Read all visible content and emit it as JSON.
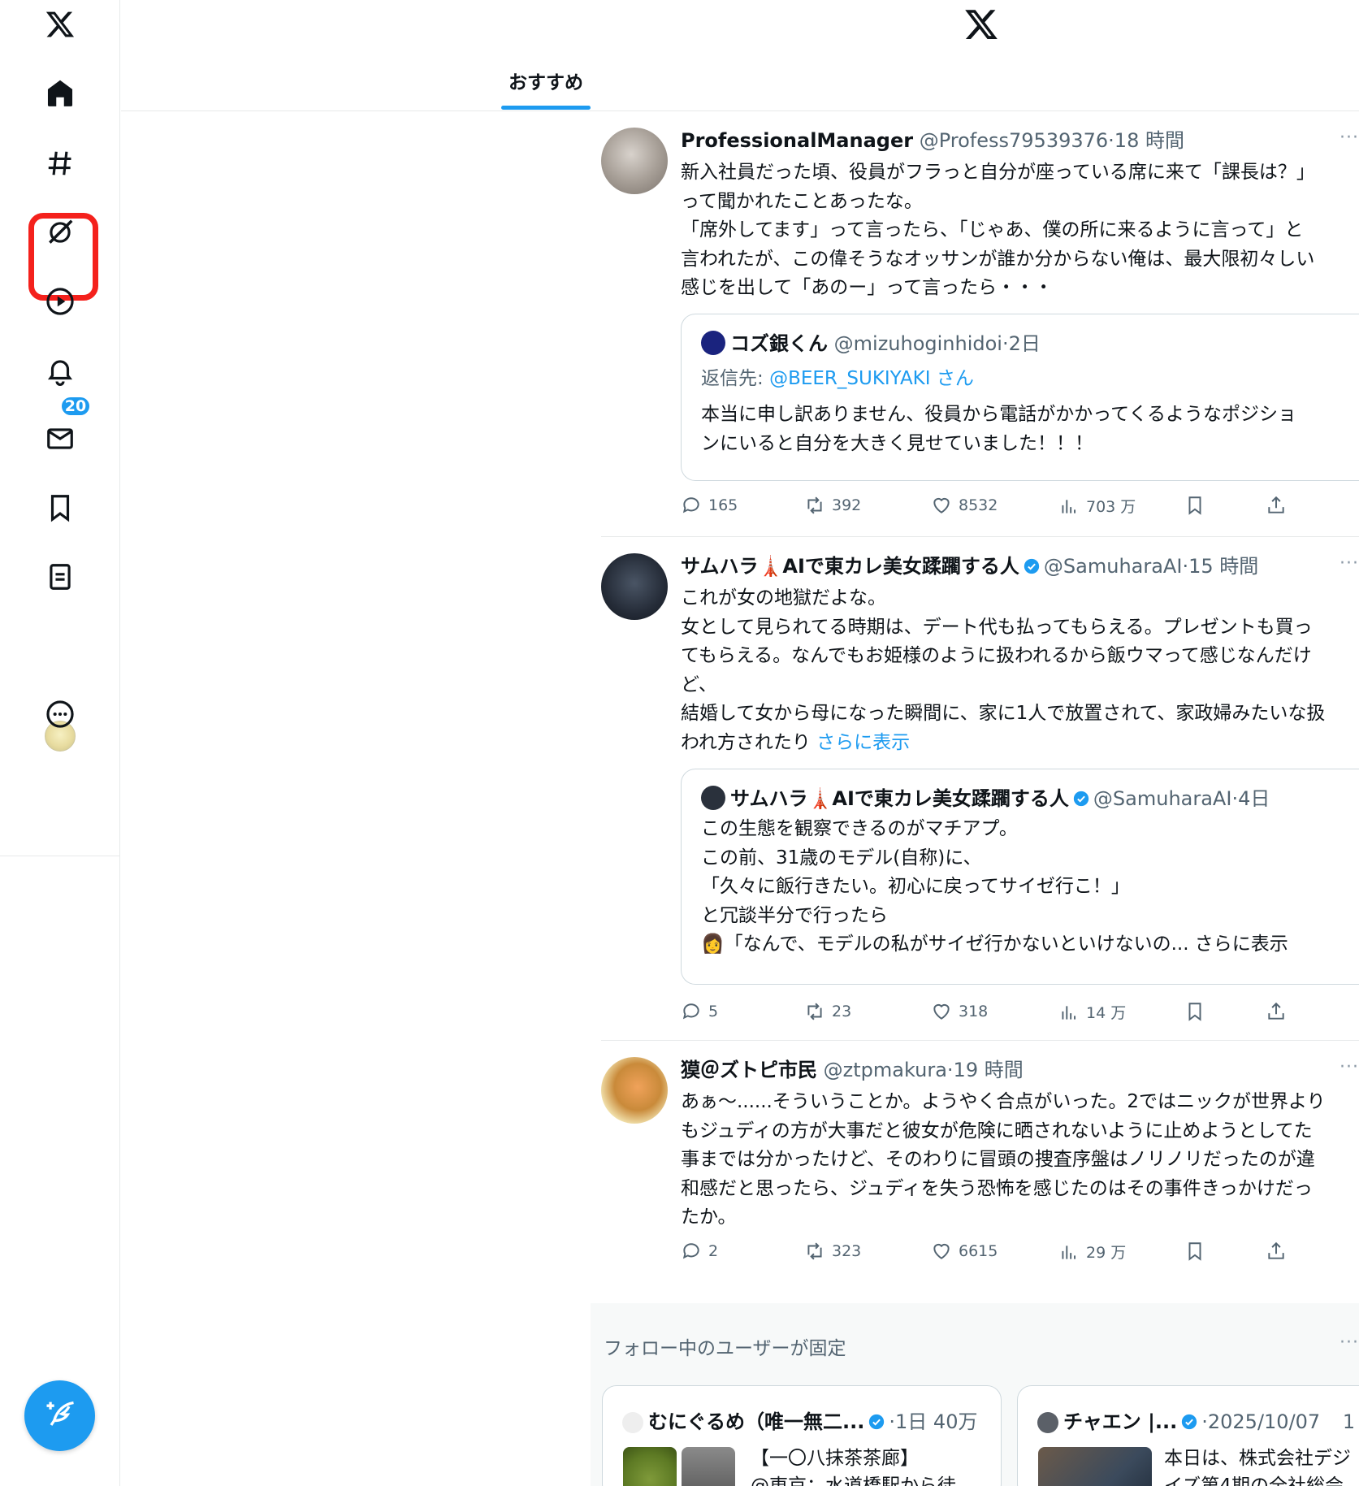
{
  "colors": {
    "accent": "#1d9bf0",
    "highlight": "#f4211c",
    "muted": "#536471",
    "text": "#0f1419"
  },
  "sidebar": {
    "items": [
      {
        "name": "x-logo",
        "icon": "x-logo-icon"
      },
      {
        "name": "home",
        "icon": "home-icon"
      },
      {
        "name": "explore",
        "icon": "hashtag-icon"
      },
      {
        "name": "grok",
        "icon": "grok-icon"
      },
      {
        "name": "video",
        "icon": "play-icon"
      },
      {
        "name": "notifications",
        "icon": "bell-icon",
        "badge": "20"
      },
      {
        "name": "messages",
        "icon": "mail-icon"
      },
      {
        "name": "bookmarks",
        "icon": "bookmark-icon"
      },
      {
        "name": "lists",
        "icon": "list-icon"
      },
      {
        "name": "profile",
        "icon": "avatar"
      },
      {
        "name": "more",
        "icon": "more-icon"
      }
    ],
    "compose_icon": "compose-icon"
  },
  "header": {
    "tab_label": "おすすめ"
  },
  "tweets": [
    {
      "name": "ProfessionalManager",
      "handle": "@Profess79539376",
      "time": "·18 時間",
      "body": [
        "新入社員だった頃、役員がフラっと自分が座っている席に来て「課長は？」",
        "って聞かれたことあったな。",
        "「席外してます」って言ったら、「じゃあ、僕の所に来るように言って」と",
        "言われたが、この偉そうなオッサンが誰か分からない俺は、最大限初々しい",
        "感じを出して「あのー」って言ったら・・・"
      ],
      "quote": {
        "name": "コズ銀くん",
        "handle": "@mizuhoginhidoi",
        "time": "·2日",
        "reply_prefix": "返信先: ",
        "reply_to": "@BEER_SUKIYAKI さん",
        "body": [
          "本当に申し訳ありません、役員から電話がかかってくるようなポジショ",
          "ンにいると自分を大きく見せていました！！！"
        ]
      },
      "stats": {
        "replies": "165",
        "retweets": "392",
        "likes": "8532",
        "views": "703 万"
      }
    },
    {
      "name": "サムハラ🗼AIで東カレ美女蹂躙する人",
      "handle": "@SamuharaAI",
      "time": "·15 時間",
      "body": [
        "これが女の地獄だよな。",
        "女として見られてる時期は、デート代も払ってもらえる。プレゼントも買っ",
        "てもらえる。なんでもお姫様のように扱われるから飯ウマって感じなんだけ",
        "ど、",
        "結婚して女から母になった瞬間に、家に1人で放置されて、家政婦みたいな扱",
        "われ方されたり "
      ],
      "show_more": "さらに表示",
      "quote": {
        "name": "サムハラ🗼AIで東カレ美女蹂躙する人",
        "handle": "@SamuharaAI",
        "time": "·4日",
        "body": [
          "この生態を観察できるのがマチアプ。",
          "この前、31歳のモデル(自称)に、",
          "「久々に飯行きたい。初心に戻ってサイゼ行こ！」",
          "と冗談半分で行ったら",
          "👩「なんで、モデルの私がサイゼ行かないといけないの... さらに表示"
        ]
      },
      "stats": {
        "replies": "5",
        "retweets": "23",
        "likes": "318",
        "views": "14 万"
      }
    },
    {
      "name": "獏＠ズトピ市民",
      "handle": "@ztpmakura",
      "time": "·19 時間",
      "body": [
        "あぁ〜......そういうことか。ようやく合点がいった。2ではニックが世界より",
        "もジュディの方が大事だと彼女が危険に晒されないように止めようとしてた",
        "事までは分かったけど、そのわりに冒頭の捜査序盤はノリノリだったのが違",
        "和感だと思ったら、ジュディを失う恐怖を感じたのはその事件きっかけだっ",
        "たか。"
      ],
      "stats": {
        "replies": "2",
        "retweets": "323",
        "likes": "6615",
        "views": "29 万"
      }
    }
  ],
  "pinned": {
    "title": "フォロー中のユーザーが固定",
    "cards": [
      {
        "name": "むにぐるめ（唯一無二...",
        "meta": "·1日 40万",
        "text_line1": "【一〇八抹茶茶廊】",
        "text_line2": "@東京：水道橋駅から徒"
      },
      {
        "name": "チャエン |...",
        "meta": "·2025/10/07",
        "meta2": "1",
        "text_line1": "本日は、株式会社デジ",
        "text_line2": "イズ第4期の全社総会"
      }
    ]
  }
}
